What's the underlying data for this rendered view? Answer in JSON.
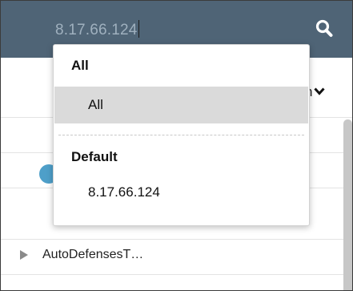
{
  "search": {
    "value": "8.17.66.124",
    "icon": "search-icon"
  },
  "header": {
    "column_label_partial": "n",
    "sort_icon": "chevron-down-icon"
  },
  "list": {
    "rows": [
      {
        "label": "AutoDefensesT…",
        "expanded": false
      }
    ]
  },
  "dropdown": {
    "groups": [
      {
        "title": "All",
        "items": [
          {
            "label": "All",
            "selected": true
          }
        ]
      },
      {
        "title": "Default",
        "items": [
          {
            "label": "8.17.66.124",
            "selected": false
          }
        ]
      }
    ]
  },
  "colors": {
    "topbar": "#4f6476",
    "search_text": "#9fb0be",
    "selected_item": "#dadada",
    "accent_circle": "#4e9fc9"
  }
}
